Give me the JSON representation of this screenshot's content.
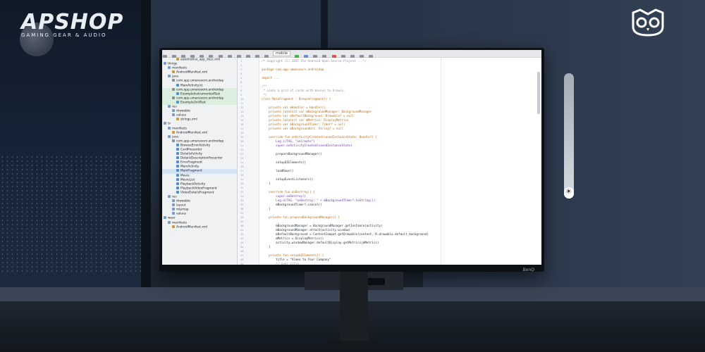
{
  "branding": {
    "logo_text": "APSHOP",
    "logo_tagline": "GAMING GEAR & AUDIO",
    "owl_icon": "owl-icon"
  },
  "monitor": {
    "brand": "BenQ",
    "power_icon": "power-icon"
  },
  "brightness": {
    "icon": "sun-icon",
    "level_fraction": 0.09
  },
  "ide": {
    "module_selector": "mobile",
    "project_tree": [
      {
        "depth": 3,
        "icon": "file",
        "label": "automotive_app_desc.xml"
      },
      {
        "depth": 0,
        "icon": "folder",
        "label": "things"
      },
      {
        "depth": 1,
        "icon": "folder",
        "label": "manifests"
      },
      {
        "depth": 2,
        "icon": "file",
        "label": "AndroidManifest.xml"
      },
      {
        "depth": 1,
        "icon": "folder",
        "label": "java"
      },
      {
        "depth": 2,
        "icon": "package",
        "label": "com.app.umansoorn.androidap"
      },
      {
        "depth": 3,
        "icon": "class",
        "label": "MainActivity.kt"
      },
      {
        "depth": 2,
        "icon": "package",
        "label": "com.app.umansoorn.androidap",
        "hl": true
      },
      {
        "depth": 3,
        "icon": "class",
        "label": "ExampleInstrumentedTest",
        "hl": true
      },
      {
        "depth": 2,
        "icon": "package",
        "label": "com.app.umansoorn.androidap",
        "hl": true
      },
      {
        "depth": 3,
        "icon": "class",
        "label": "ExampleUnitTest",
        "hl": true
      },
      {
        "depth": 1,
        "icon": "folder",
        "label": "res"
      },
      {
        "depth": 2,
        "icon": "folder",
        "label": "drawable"
      },
      {
        "depth": 2,
        "icon": "folder",
        "label": "values"
      },
      {
        "depth": 3,
        "icon": "file",
        "label": "strings.xml"
      },
      {
        "depth": 0,
        "icon": "folder",
        "label": "tv"
      },
      {
        "depth": 1,
        "icon": "folder",
        "label": "manifests"
      },
      {
        "depth": 2,
        "icon": "file",
        "label": "AndroidManifest.xml"
      },
      {
        "depth": 1,
        "icon": "folder",
        "label": "java"
      },
      {
        "depth": 2,
        "icon": "package",
        "label": "com.app.umansoorn.androidap"
      },
      {
        "depth": 3,
        "icon": "class",
        "label": "BrowseErrorActivity"
      },
      {
        "depth": 3,
        "icon": "class",
        "label": "CardPresenter"
      },
      {
        "depth": 3,
        "icon": "class",
        "label": "DetailsActivity"
      },
      {
        "depth": 3,
        "icon": "class",
        "label": "DetailsDescriptionPresenter"
      },
      {
        "depth": 3,
        "icon": "class",
        "label": "ErrorFragment"
      },
      {
        "depth": 3,
        "icon": "class",
        "label": "MainActivity"
      },
      {
        "depth": 3,
        "icon": "class",
        "label": "MainFragment",
        "sel": true
      },
      {
        "depth": 3,
        "icon": "class",
        "label": "Movie"
      },
      {
        "depth": 3,
        "icon": "class",
        "label": "MovieList"
      },
      {
        "depth": 3,
        "icon": "class",
        "label": "PlaybackActivity"
      },
      {
        "depth": 3,
        "icon": "class",
        "label": "PlaybackVideoFragment"
      },
      {
        "depth": 3,
        "icon": "class",
        "label": "VideoDetailsFragment"
      },
      {
        "depth": 1,
        "icon": "folder",
        "label": "res"
      },
      {
        "depth": 2,
        "icon": "folder",
        "label": "drawable"
      },
      {
        "depth": 2,
        "icon": "folder",
        "label": "layout"
      },
      {
        "depth": 2,
        "icon": "folder",
        "label": "mipmap"
      },
      {
        "depth": 2,
        "icon": "folder",
        "label": "values"
      },
      {
        "depth": 0,
        "icon": "folder",
        "label": "wear"
      },
      {
        "depth": 1,
        "icon": "folder",
        "label": "manifests"
      },
      {
        "depth": 2,
        "icon": "file",
        "label": "AndroidManifest.xml"
      }
    ],
    "code_lines": [
      "/* Copyright (C) 2017 The Android Open Source Project ...*/",
      "",
      "package com.app.umansoorn.androidap",
      "",
      "import ...",
      "",
      "/**",
      " * Loads a grid of cards with movies to browse.",
      " */",
      "class MainFragment : BrowseFragment() {",
      "",
      "    private val mHandler = Handler()",
      "    private lateinit var mBackgroundManager: BackgroundManager",
      "    private var mDefaultBackground: Drawable? = null",
      "    private lateinit var mMetrics: DisplayMetrics",
      "    private var mBackgroundTimer: Timer? = null",
      "    private var mBackgroundUri: String? = null",
      "",
      "    override fun onActivityCreated(savedInstanceState: Bundle?) {",
      "        Log.i(TAG, \"onCreate\")",
      "        super.onActivityCreated(savedInstanceState)",
      "",
      "        prepareBackgroundManager()",
      "",
      "        setupUIElements()",
      "",
      "        loadRows()",
      "",
      "        setupEventListeners()",
      "    }",
      "",
      "    override fun onDestroy() {",
      "        super.onDestroy()",
      "        Log.d(TAG, \"onDestroy: \" + mBackgroundTimer?.toString())",
      "        mBackgroundTimer?.cancel()",
      "    }",
      "",
      "    private fun prepareBackgroundManager() {",
      "",
      "        mBackgroundManager = BackgroundManager.getInstance(activity)",
      "        mBackgroundManager.attach(activity.window)",
      "        mDefaultBackground = ContextCompat.getDrawable(context, R.drawable.default_background)",
      "        mMetrics = DisplayMetrics()",
      "        activity.windowManager.defaultDisplay.getMetrics(mMetrics)",
      "    }",
      "",
      "    private fun setupUIElements() {",
      "        title = \"Vimeo to Your Company\"",
      "        // over title"
    ]
  }
}
